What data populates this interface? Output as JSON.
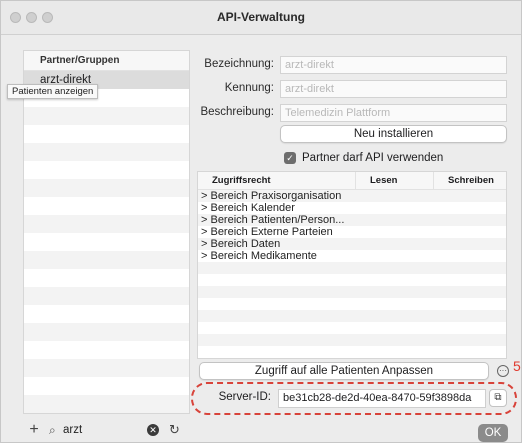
{
  "window": {
    "title": "API-Verwaltung"
  },
  "partners": {
    "header": "Partner/Gruppen",
    "items": [
      "arzt-direkt"
    ],
    "selected_tooltip": "Patienten anzeigen",
    "search_value": "arzt"
  },
  "form": {
    "bezeichnung_label": "Bezeichnung:",
    "bezeichnung_value": "arzt-direkt",
    "kennung_label": "Kennung:",
    "kennung_value": "arzt-direkt",
    "beschreibung_label": "Beschreibung:",
    "beschreibung_value": "Telemedizin Plattform",
    "install_button": "Neu installieren",
    "partner_checkbox": "Partner darf API verwenden",
    "partner_checked": true
  },
  "permissions": {
    "col_access": "Zugriffsrecht",
    "col_read": "Lesen",
    "col_write": "Schreiben",
    "rows": [
      "> Bereich Praxisorganisation",
      "> Bereich Kalender",
      "> Bereich Patienten/Person...",
      "> Bereich Externe Parteien",
      "> Bereich Daten",
      "> Bereich Medikamente"
    ]
  },
  "patients_button": "Zugriff auf alle Patienten Anpassen",
  "annotation": "5",
  "server": {
    "label": "Server-ID:",
    "value": "be31cb28-de2d-40ea-8470-59f3898da"
  },
  "ok_button": "OK",
  "icons": [
    "close-icon",
    "minimize-icon",
    "zoom-icon",
    "plus-icon",
    "search-icon",
    "clear-icon",
    "refresh-icon",
    "more-icon",
    "copy-icon"
  ]
}
